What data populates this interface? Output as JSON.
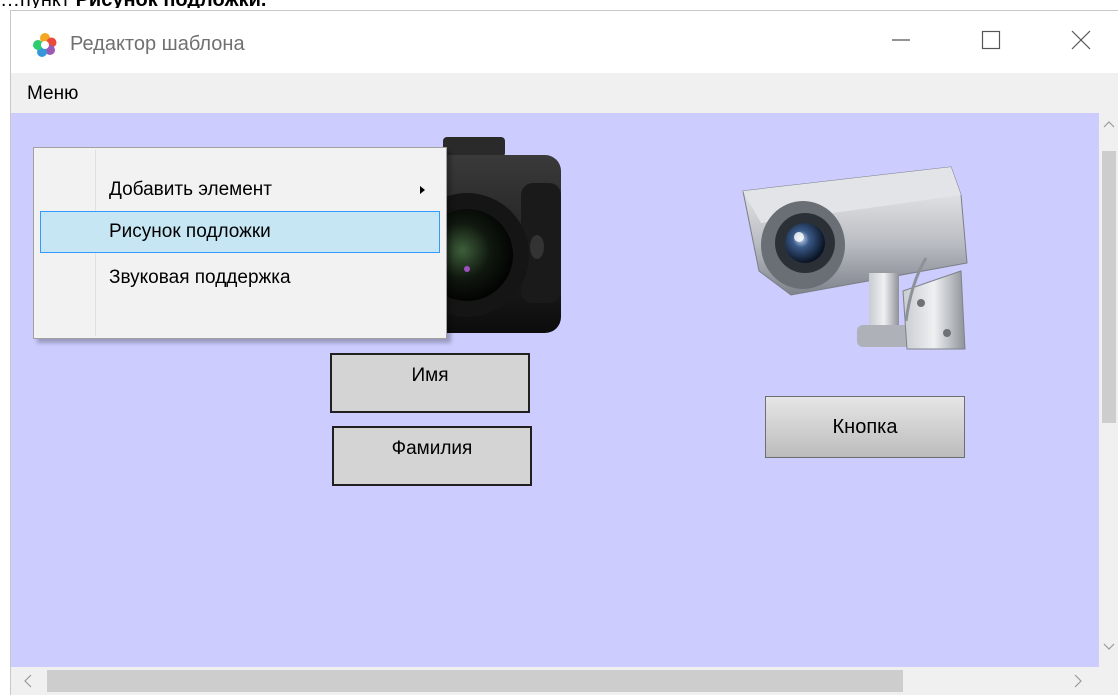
{
  "doc_caption": {
    "prefix": "…пункт ",
    "bold": "Рисунок подложки."
  },
  "window": {
    "title": "Редактор шаблона",
    "icon": "app-logo-icon",
    "controls": {
      "minimize": "minimize-icon",
      "maximize": "maximize-icon",
      "close": "close-icon"
    }
  },
  "menubar": {
    "items": [
      {
        "label": "Меню"
      }
    ]
  },
  "context_menu": {
    "items": [
      {
        "label": "Добавить элемент",
        "has_submenu": true
      },
      {
        "label": "Рисунок подложки",
        "highlighted": true
      },
      {
        "label": "Звуковая поддержка"
      }
    ]
  },
  "canvas": {
    "background": "#ccccff",
    "images": {
      "camera": "photo-camera-image",
      "cctv": "security-camera-image"
    },
    "fields": [
      {
        "label": "Имя"
      },
      {
        "label": "Фамилия"
      }
    ],
    "button": {
      "label": "Кнопка"
    }
  },
  "colors": {
    "highlight_bg": "#c6e6f4",
    "highlight_border": "#3399ff",
    "canvas_bg": "#ccccff"
  }
}
